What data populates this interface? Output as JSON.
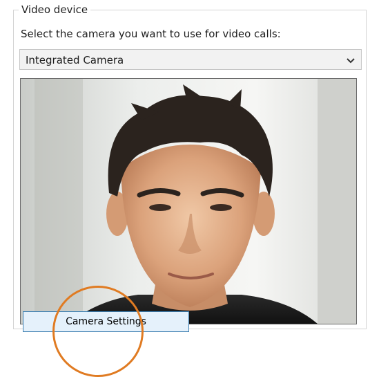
{
  "video_device": {
    "group_title": "Video device",
    "prompt": "Select the camera you want to use for video calls:",
    "selected_camera": "Integrated Camera",
    "dropdown_icon": "chevron-down-icon"
  },
  "preview": {
    "content": "camera-preview-image"
  },
  "actions": {
    "camera_settings_label": "Camera Settings"
  },
  "colors": {
    "button_background": "#e5f1fb",
    "button_border": "#3c7fb1",
    "highlight_circle": "#e07b22"
  }
}
